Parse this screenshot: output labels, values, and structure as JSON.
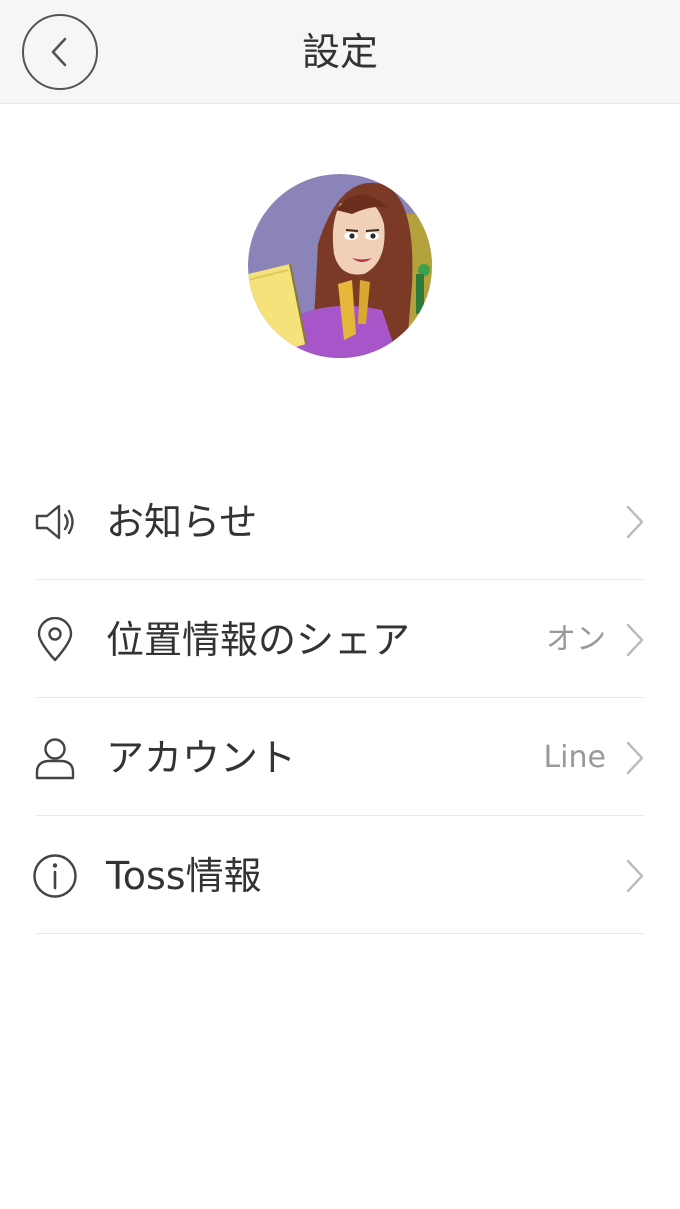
{
  "header": {
    "title": "設定",
    "back_icon": "chevron-left-icon"
  },
  "profile": {
    "avatar": "user-avatar-cartoon"
  },
  "menu": {
    "items": [
      {
        "icon": "speaker-icon",
        "label": "お知らせ",
        "value": ""
      },
      {
        "icon": "location-pin-icon",
        "label": "位置情報のシェア",
        "value": "オン"
      },
      {
        "icon": "person-icon",
        "label": "アカウント",
        "value": "Line"
      },
      {
        "icon": "info-icon",
        "label": "Toss情報",
        "value": ""
      }
    ]
  },
  "colors": {
    "header_bg": "#f6f6f6",
    "text": "#333333",
    "secondary_text": "#999999",
    "divider": "#e9e9e9",
    "chevron": "#bbbbbb"
  }
}
